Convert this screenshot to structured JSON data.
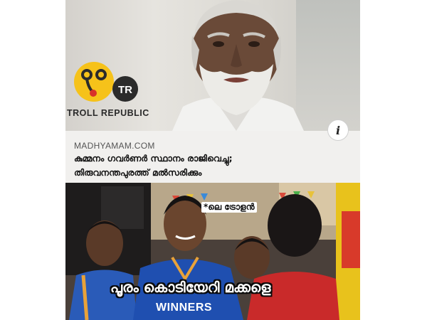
{
  "post": {
    "brand": {
      "logo_badge": "TR",
      "name": "TROLL REPUBLIC"
    },
    "info_button_label": "i",
    "link_card": {
      "source": "MADHYAMAM.COM",
      "title_line1": "കുമ്മനം ഗവർണർ സ്ഥാനം രാജിവെച്ചു;",
      "title_line2": "തിരുവനന്തപുരത്ത് മൽസരിക്കും"
    },
    "meme": {
      "caption_small": "*ലെ ട്രോളൻ",
      "caption_big": "പൂരം കൊടിയേറി മക്കളെ",
      "jersey_text": "WINNERS"
    }
  },
  "colors": {
    "logo_yellow": "#f6c21a",
    "logo_dark": "#2b2b2b",
    "logo_red": "#d8302a",
    "card_bg": "#f1f0ee",
    "jersey_blue": "#1f4fb0",
    "caption_stroke": "#0a0a0a"
  },
  "icons": {
    "logo": "troll-republic-logo",
    "info": "info-icon"
  }
}
